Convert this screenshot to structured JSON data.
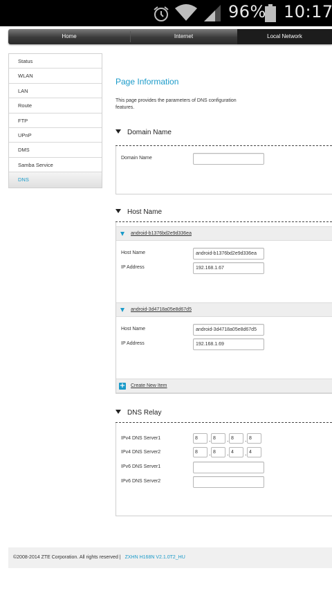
{
  "status_bar": {
    "battery_percent": "96%",
    "time": "10:17",
    "icons": [
      "alarm-icon",
      "wifi-icon",
      "signal-icon",
      "battery-icon"
    ]
  },
  "top_nav": {
    "tabs": [
      {
        "label": "Home"
      },
      {
        "label": "Internet"
      },
      {
        "label": "Local Network",
        "active": true
      }
    ]
  },
  "sidebar": {
    "items": [
      {
        "label": "Status"
      },
      {
        "label": "WLAN"
      },
      {
        "label": "LAN"
      },
      {
        "label": "Route"
      },
      {
        "label": "FTP"
      },
      {
        "label": "UPnP"
      },
      {
        "label": "DMS"
      },
      {
        "label": "Samba Service"
      },
      {
        "label": "DNS",
        "active": true
      }
    ]
  },
  "main": {
    "title": "Page Information",
    "description": "This page provides the parameters of DNS configuration features.",
    "domain_section": {
      "title": "Domain Name",
      "field_label": "Domain Name",
      "field_value": ""
    },
    "host_section": {
      "title": "Host Name",
      "entries": [
        {
          "header": "android-b1376bd2e9d336ea",
          "host_label": "Host Name",
          "host_value": "android-b1376bd2e9d336ea",
          "ip_label": "IP Address",
          "ip_value": "192.168.1.67"
        },
        {
          "header": "android-3d4718a05e8d67d5",
          "host_label": "Host Name",
          "host_value": "android-3d4718a05e8d67d5",
          "ip_label": "IP Address",
          "ip_value": "192.168.1.69"
        }
      ],
      "create_label": "Create New Item"
    },
    "dns_relay": {
      "title": "DNS Relay",
      "ipv4_1_label": "IPv4 DNS Server1",
      "ipv4_1": [
        "8",
        "8",
        "8",
        "8"
      ],
      "ipv4_2_label": "IPv4 DNS Server2",
      "ipv4_2": [
        "8",
        "8",
        "4",
        "4"
      ],
      "ipv6_1_label": "IPv6 DNS Server1",
      "ipv6_1": "",
      "ipv6_2_label": "IPv6 DNS Server2",
      "ipv6_2": ""
    }
  },
  "footer": {
    "copyright": "©2008-2014 ZTE Corporation. All rights reserved  |",
    "version": "ZXHN H168N V2.1.0T2_HU"
  },
  "colors": {
    "accent": "#1a9ac9",
    "nav_dark": "#2a2a2a"
  }
}
